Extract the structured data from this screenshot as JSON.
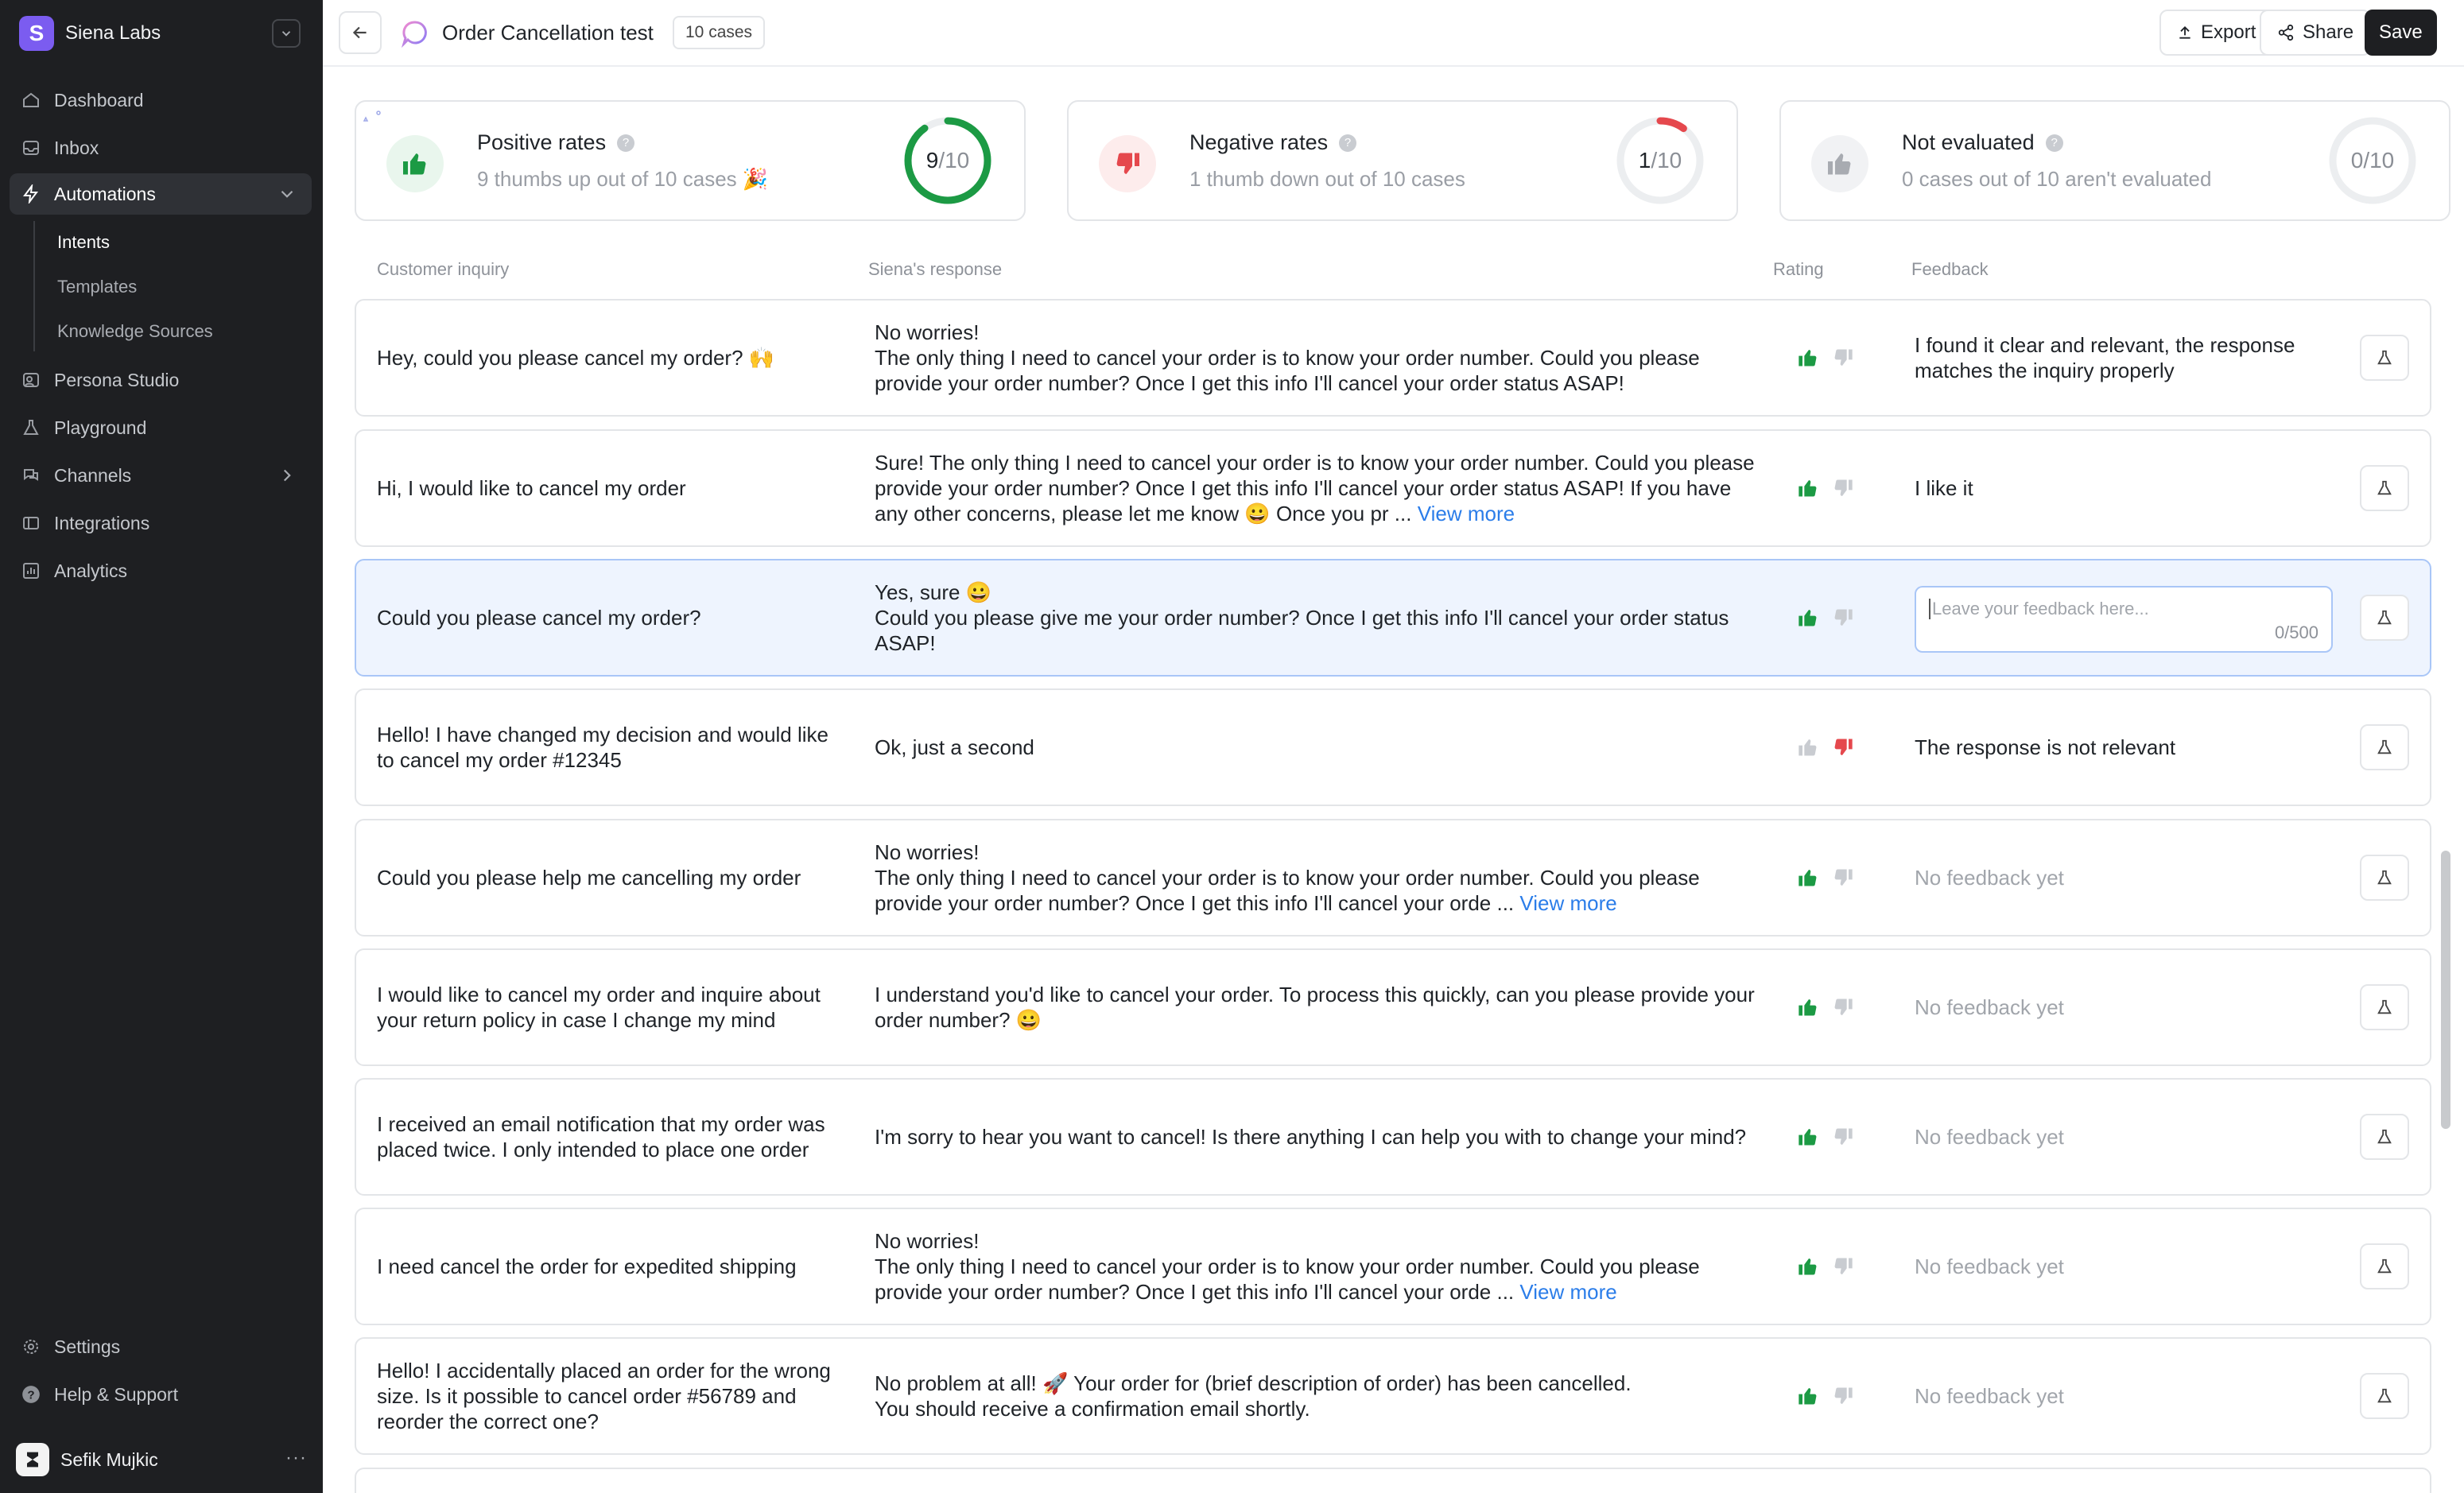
{
  "workspace": {
    "name": "Siena Labs",
    "logo_letter": "S"
  },
  "nav": {
    "dashboard": "Dashboard",
    "inbox": "Inbox",
    "automations": "Automations",
    "intents": "Intents",
    "templates": "Templates",
    "knowledge_sources": "Knowledge Sources",
    "persona_studio": "Persona Studio",
    "playground": "Playground",
    "channels": "Channels",
    "integrations": "Integrations",
    "analytics": "Analytics",
    "settings": "Settings",
    "help": "Help & Support"
  },
  "user": {
    "name": "Sefik Mujkic",
    "more": "···"
  },
  "header": {
    "title": "Order Cancellation test",
    "cases_badge": "10 cases",
    "export": "Export",
    "share": "Share",
    "save": "Save"
  },
  "stats": {
    "positive": {
      "title": "Positive rates",
      "subtitle": "9 thumbs up out of 10 cases 🎉",
      "num": "9",
      "den": "/10",
      "fraction": 0.9,
      "color": "#1c9a44"
    },
    "negative": {
      "title": "Negative rates",
      "subtitle": "1 thumb down out of 10 cases",
      "num": "1",
      "den": "/10",
      "fraction": 0.1,
      "color": "#e5484d"
    },
    "not_evaluated": {
      "title": "Not evaluated",
      "subtitle": "0 cases out of 10 aren't evaluated",
      "num": "0",
      "den": "/10",
      "fraction": 0.0,
      "color": "#9a9ea5"
    }
  },
  "columns": {
    "inquiry": "Customer inquiry",
    "response": "Siena's response",
    "rating": "Rating",
    "feedback": "Feedback"
  },
  "rows": [
    {
      "inquiry": "Hey, could you please cancel my order? 🙌",
      "response": "No worries!\nThe only thing I need to cancel your order is to know your order number. Could you please provide your order number? Once I get this info I'll cancel your order status ASAP!",
      "more": "",
      "rating": "up",
      "feedback": "I found it clear and relevant, the response matches the inquiry properly"
    },
    {
      "inquiry": "Hi, I would like to cancel my order",
      "response": "Sure! The only thing I need to cancel your order is to know your order number. Could you please provide your order number? Once I get this info I'll cancel your order status ASAP! If you have any other concerns, please let me know 😀 Once you pr ...",
      "more": "View more",
      "rating": "up",
      "feedback": "I like it"
    },
    {
      "inquiry": "Could you please cancel my order?",
      "response": "Yes, sure 😀\nCould you please give me your order number? Once I get this info I'll cancel your order status ASAP!",
      "more": "",
      "rating": "up",
      "feedback": "",
      "input_placeholder": "Leave your feedback here...",
      "input_count": "0/500"
    },
    {
      "inquiry": "Hello! I have changed my decision and would like to cancel my order #12345",
      "response": "Ok, just a second",
      "more": "",
      "rating": "down",
      "feedback": "The response is not relevant"
    },
    {
      "inquiry": "Could you please help me cancelling my order",
      "response": "No worries!\nThe only thing I need to cancel your order is to know your order number. Could you please provide your order number? Once I get this info I'll cancel your orde ...",
      "more": "View more",
      "rating": "up",
      "feedback": "No feedback yet"
    },
    {
      "inquiry": "I would like to cancel my order and inquire about your return policy in case I change my mind",
      "response": "I understand you'd like to cancel your order. To process this quickly, can you please provide your order number? 😀",
      "more": "",
      "rating": "up",
      "feedback": "No feedback yet"
    },
    {
      "inquiry": "I received an email notification that my order was placed twice. I only intended to place one order",
      "response": "I'm sorry to hear you want to cancel! Is there anything I can help you with to change your mind?",
      "more": "",
      "rating": "up",
      "feedback": "No feedback yet"
    },
    {
      "inquiry": "I need cancel the order for expedited shipping",
      "response": " No worries!\nThe only thing I need to cancel your order is to know your order number. Could you please provide your order number? Once I get this info I'll cancel your orde ...",
      "more": "View more",
      "rating": "up",
      "feedback": "No feedback yet"
    },
    {
      "inquiry": "Hello! I accidentally placed an order for the wrong size. Is it possible to cancel order #56789 and reorder the correct one?",
      "response": "No problem at all! 🚀 Your order for (brief description of order) has been cancelled.\nYou should receive a confirmation email shortly.",
      "more": "",
      "rating": "up",
      "feedback": "No feedback yet"
    }
  ],
  "colors": {
    "accent_green": "#1c9a44",
    "accent_red": "#e5484d",
    "link_blue": "#2b7de9",
    "selected_row": "#eef4fe"
  }
}
